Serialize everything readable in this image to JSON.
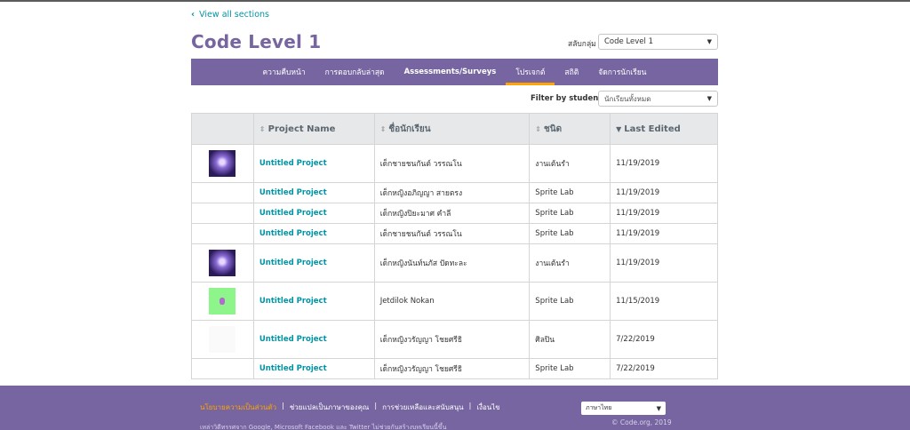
{
  "nav": {
    "back_label": "View all sections"
  },
  "header": {
    "title": "Code Level 1",
    "section_label": "สลับกลุ่ม",
    "section_value": "Code Level 1"
  },
  "tabs": [
    {
      "label": "ความคืบหน้า",
      "bold": false,
      "active": false
    },
    {
      "label": "การตอบกลับล่าสุด",
      "bold": false,
      "active": false
    },
    {
      "label": "Assessments/Surveys",
      "bold": true,
      "active": false
    },
    {
      "label": "โปรเจกต์",
      "bold": false,
      "active": true
    },
    {
      "label": "สถิติ",
      "bold": false,
      "active": false
    },
    {
      "label": "จัดการนักเรียน",
      "bold": false,
      "active": false
    }
  ],
  "filter": {
    "label": "Filter by student:",
    "value": "นักเรียนทั้งหมด"
  },
  "table": {
    "headers": {
      "name": "Project Name",
      "student": "ชื่อนักเรียน",
      "type": "ชนิด",
      "edited": "Last Edited"
    },
    "rows": [
      {
        "thumb": "dance",
        "name": "Untitled Project",
        "student": "เด็กชายชนกันต์ วรรณโน",
        "type": "งานเต้นรำ",
        "edited": "11/19/2019"
      },
      {
        "thumb": "",
        "name": "Untitled Project",
        "student": "เด็กหญิงอภิญญา สายตรง",
        "type": "Sprite Lab",
        "edited": "11/19/2019"
      },
      {
        "thumb": "",
        "name": "Untitled Project",
        "student": "เด็กหญิงปิยะมาศ คำลี",
        "type": "Sprite Lab",
        "edited": "11/19/2019"
      },
      {
        "thumb": "",
        "name": "Untitled Project",
        "student": "เด็กชายชนกันต์ วรรณโน",
        "type": "Sprite Lab",
        "edited": "11/19/2019"
      },
      {
        "thumb": "dance",
        "name": "Untitled Project",
        "student": "เด็กหญิงนันท์นภัส ปัดทะละ",
        "type": "งานเต้นรำ",
        "edited": "11/19/2019"
      },
      {
        "thumb": "sprite",
        "name": "Untitled Project",
        "student": "Jetdilok Nokan",
        "type": "Sprite Lab",
        "edited": "11/15/2019"
      },
      {
        "thumb": "blank",
        "name": "Untitled Project",
        "student": "เด็กหญิงวรัญญา โชยศรีธิ",
        "type": "ศิลปิน",
        "edited": "7/22/2019"
      },
      {
        "thumb": "",
        "name": "Untitled Project",
        "student": "เด็กหญิงวรัญญา โชยศรีธิ",
        "type": "Sprite Lab",
        "edited": "7/22/2019"
      }
    ]
  },
  "footer": {
    "links": [
      "นโยบายความเป็นส่วนตัว",
      "ช่วยแปลเป็นภาษาของคุณ",
      "การช่วยเหลือและสนับสนุน",
      "เงื่อนไข"
    ],
    "note": "เหล่าวิดีทรรศจาก Google, Microsoft Facebook และ Twitter ไม่ช่วยกันสร้างบทเรียนนี้ขึ้น",
    "language": "ภาษาไทย",
    "copyright": "© Code.org, 2019"
  },
  "colors": {
    "brand": "#7665a0",
    "accent": "#ffa400",
    "link": "#0094a5"
  }
}
